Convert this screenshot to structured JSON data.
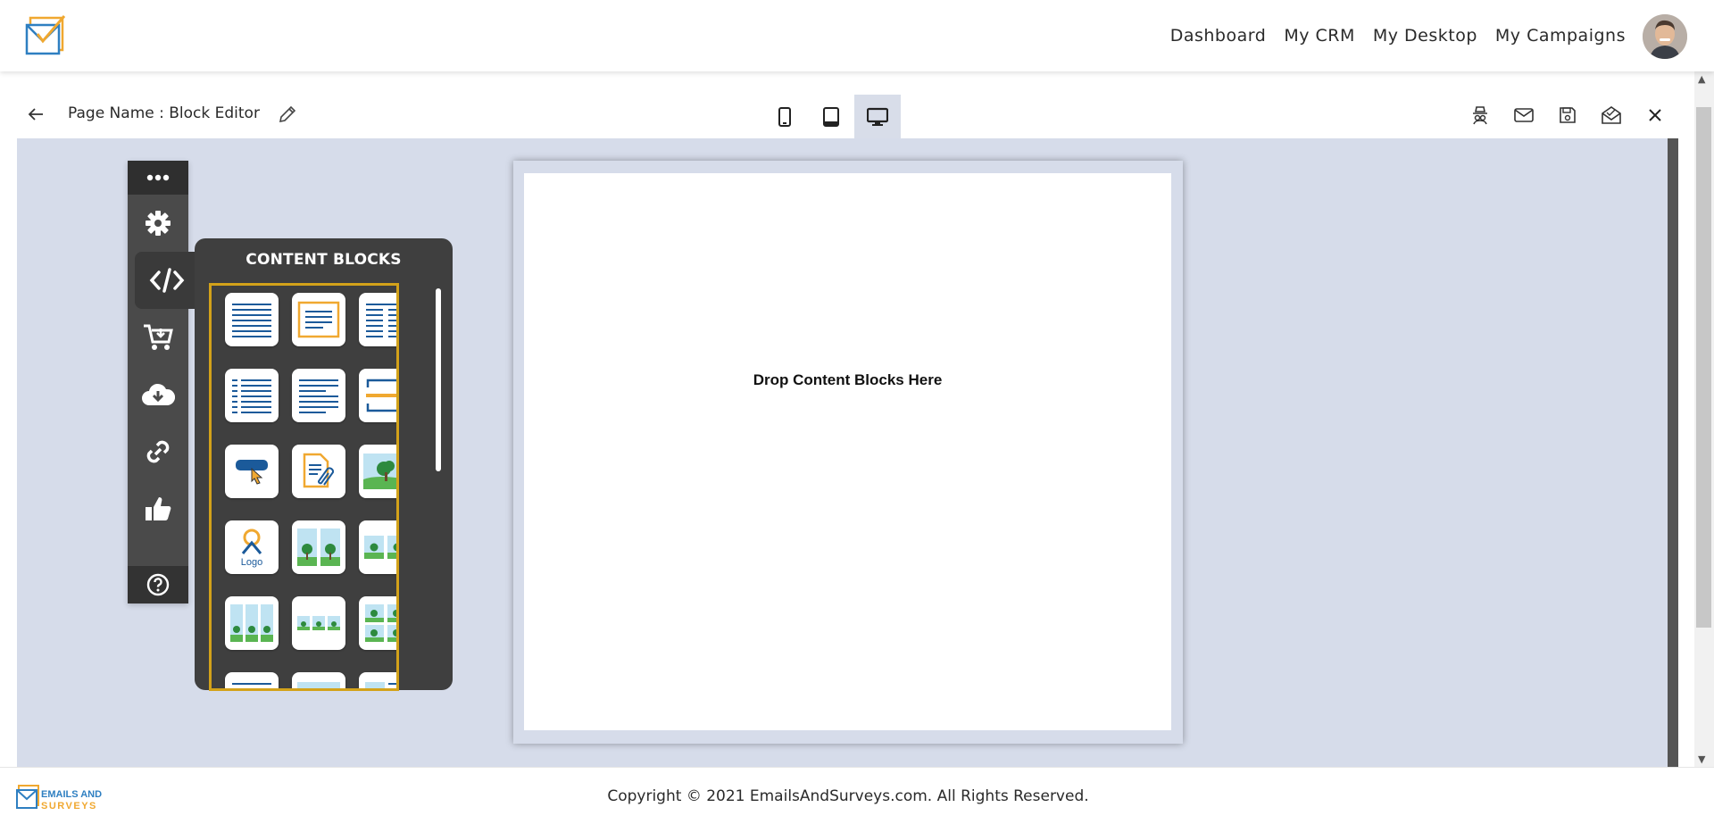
{
  "nav": {
    "links": [
      "Dashboard",
      "My CRM",
      "My Desktop",
      "My Campaigns"
    ]
  },
  "toolbar": {
    "page_name": "Page Name : Block Editor",
    "active_device": "desktop"
  },
  "panel": {
    "title": "CONTENT BLOCKS"
  },
  "stage": {
    "drop_text": "Drop Content Blocks Here"
  },
  "footer": {
    "copyright": "Copyright © 2021 EmailsAndSurveys.com. All Rights Reserved.",
    "logo_line1": "EMAILS AND",
    "logo_line2": "SURVEYS"
  },
  "blocks": [
    "text-one-column-icon",
    "text-boxed-icon",
    "text-two-column-icon",
    "text-list-icon",
    "text-justified-icon",
    "divider-icon",
    "button-icon",
    "attachment-icon",
    "image-icon",
    "logo-icon",
    "two-images-icon",
    "two-small-images-icon",
    "three-images-icon",
    "three-small-images-icon",
    "four-images-icon",
    "text-partial-icon",
    "image-partial-icon",
    "image-text-partial-icon"
  ],
  "colors": {
    "accent": "#d3a21a",
    "canvas": "#d6dcea",
    "dock": "#4a4a4a",
    "blue": "#1b5a9a",
    "orange": "#f0a830"
  }
}
